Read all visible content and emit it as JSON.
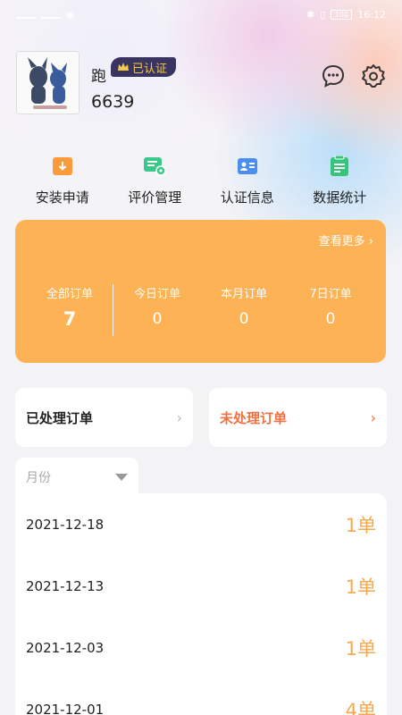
{
  "status_bar": {
    "time": "16:12",
    "battery": "100"
  },
  "profile": {
    "name": "跑",
    "badge": "已认证",
    "uid": "6639"
  },
  "quick_actions": [
    {
      "label": "安装申请",
      "icon": "install-request-icon",
      "color": "#fb9a3c"
    },
    {
      "label": "评价管理",
      "icon": "review-manage-icon",
      "color": "#3cc88a"
    },
    {
      "label": "认证信息",
      "icon": "certification-info-icon",
      "color": "#4a8ff0"
    },
    {
      "label": "数据统计",
      "icon": "data-stats-icon",
      "color": "#34c47a"
    }
  ],
  "orders": {
    "see_more": "查看更多",
    "stats": [
      {
        "label": "全部订单",
        "value": "7"
      },
      {
        "label": "今日订单",
        "value": "0"
      },
      {
        "label": "本月订单",
        "value": "0"
      },
      {
        "label": "7日订单",
        "value": "0"
      }
    ],
    "accent": "#fdb255"
  },
  "tabs": {
    "processed": "已处理订单",
    "unprocessed": "未处理订单",
    "unprocessed_color": "#f07040"
  },
  "month_filter": {
    "placeholder": "月份"
  },
  "daily_list": [
    {
      "date": "2021-12-18",
      "count": "1单"
    },
    {
      "date": "2021-12-13",
      "count": "1单"
    },
    {
      "date": "2021-12-03",
      "count": "1单"
    },
    {
      "date": "2021-12-01",
      "count": "4单"
    }
  ]
}
